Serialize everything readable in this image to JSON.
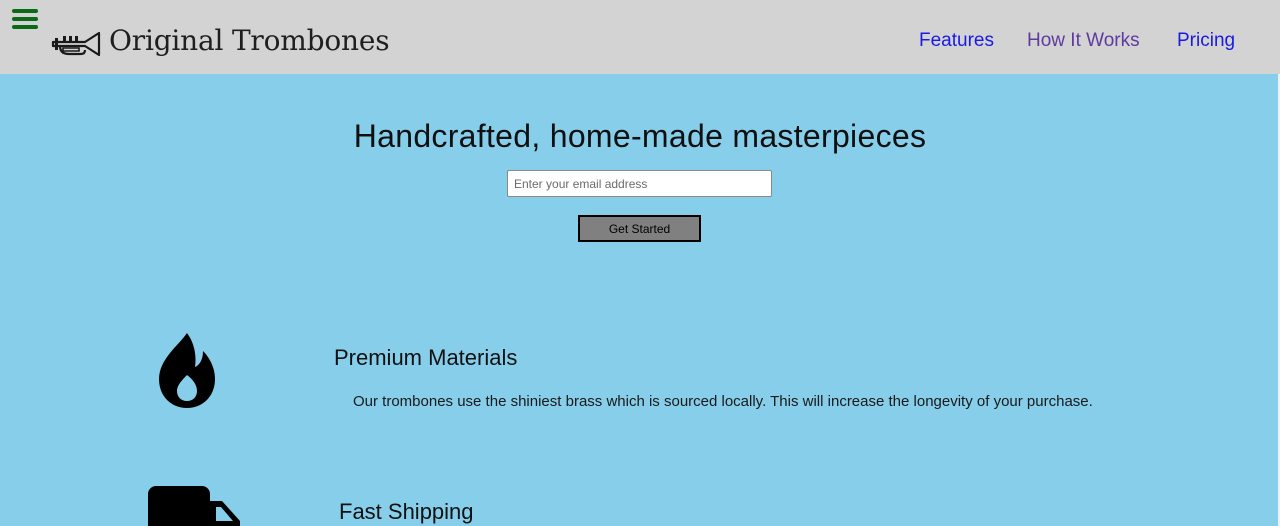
{
  "header": {
    "menu_icon": "hamburger-menu-icon",
    "brand_icon": "trumpet-icon",
    "brand_name": "Original Trombones",
    "nav": [
      {
        "label": "Features",
        "state": "unvisited"
      },
      {
        "label": "How It Works",
        "state": "visited"
      },
      {
        "label": "Pricing",
        "state": "unvisited"
      }
    ]
  },
  "hero": {
    "title": "Handcrafted, home-made masterpieces",
    "email_placeholder": "Enter your email address",
    "email_value": "",
    "button_label": "Get Started"
  },
  "features": [
    {
      "icon": "fire-icon",
      "title": "Premium Materials",
      "description": "Our trombones use the shiniest brass which is sourced locally. This will increase the longevity of your purchase."
    },
    {
      "icon": "truck-icon",
      "title": "Fast Shipping",
      "description": ""
    }
  ],
  "colors": {
    "header_bg": "#d3d3d3",
    "page_bg": "#87ceeb",
    "menu_icon": "#0a6a16",
    "link": "#1a1ae6",
    "link_visited": "#5f3ba0",
    "button_bg": "#808080"
  }
}
